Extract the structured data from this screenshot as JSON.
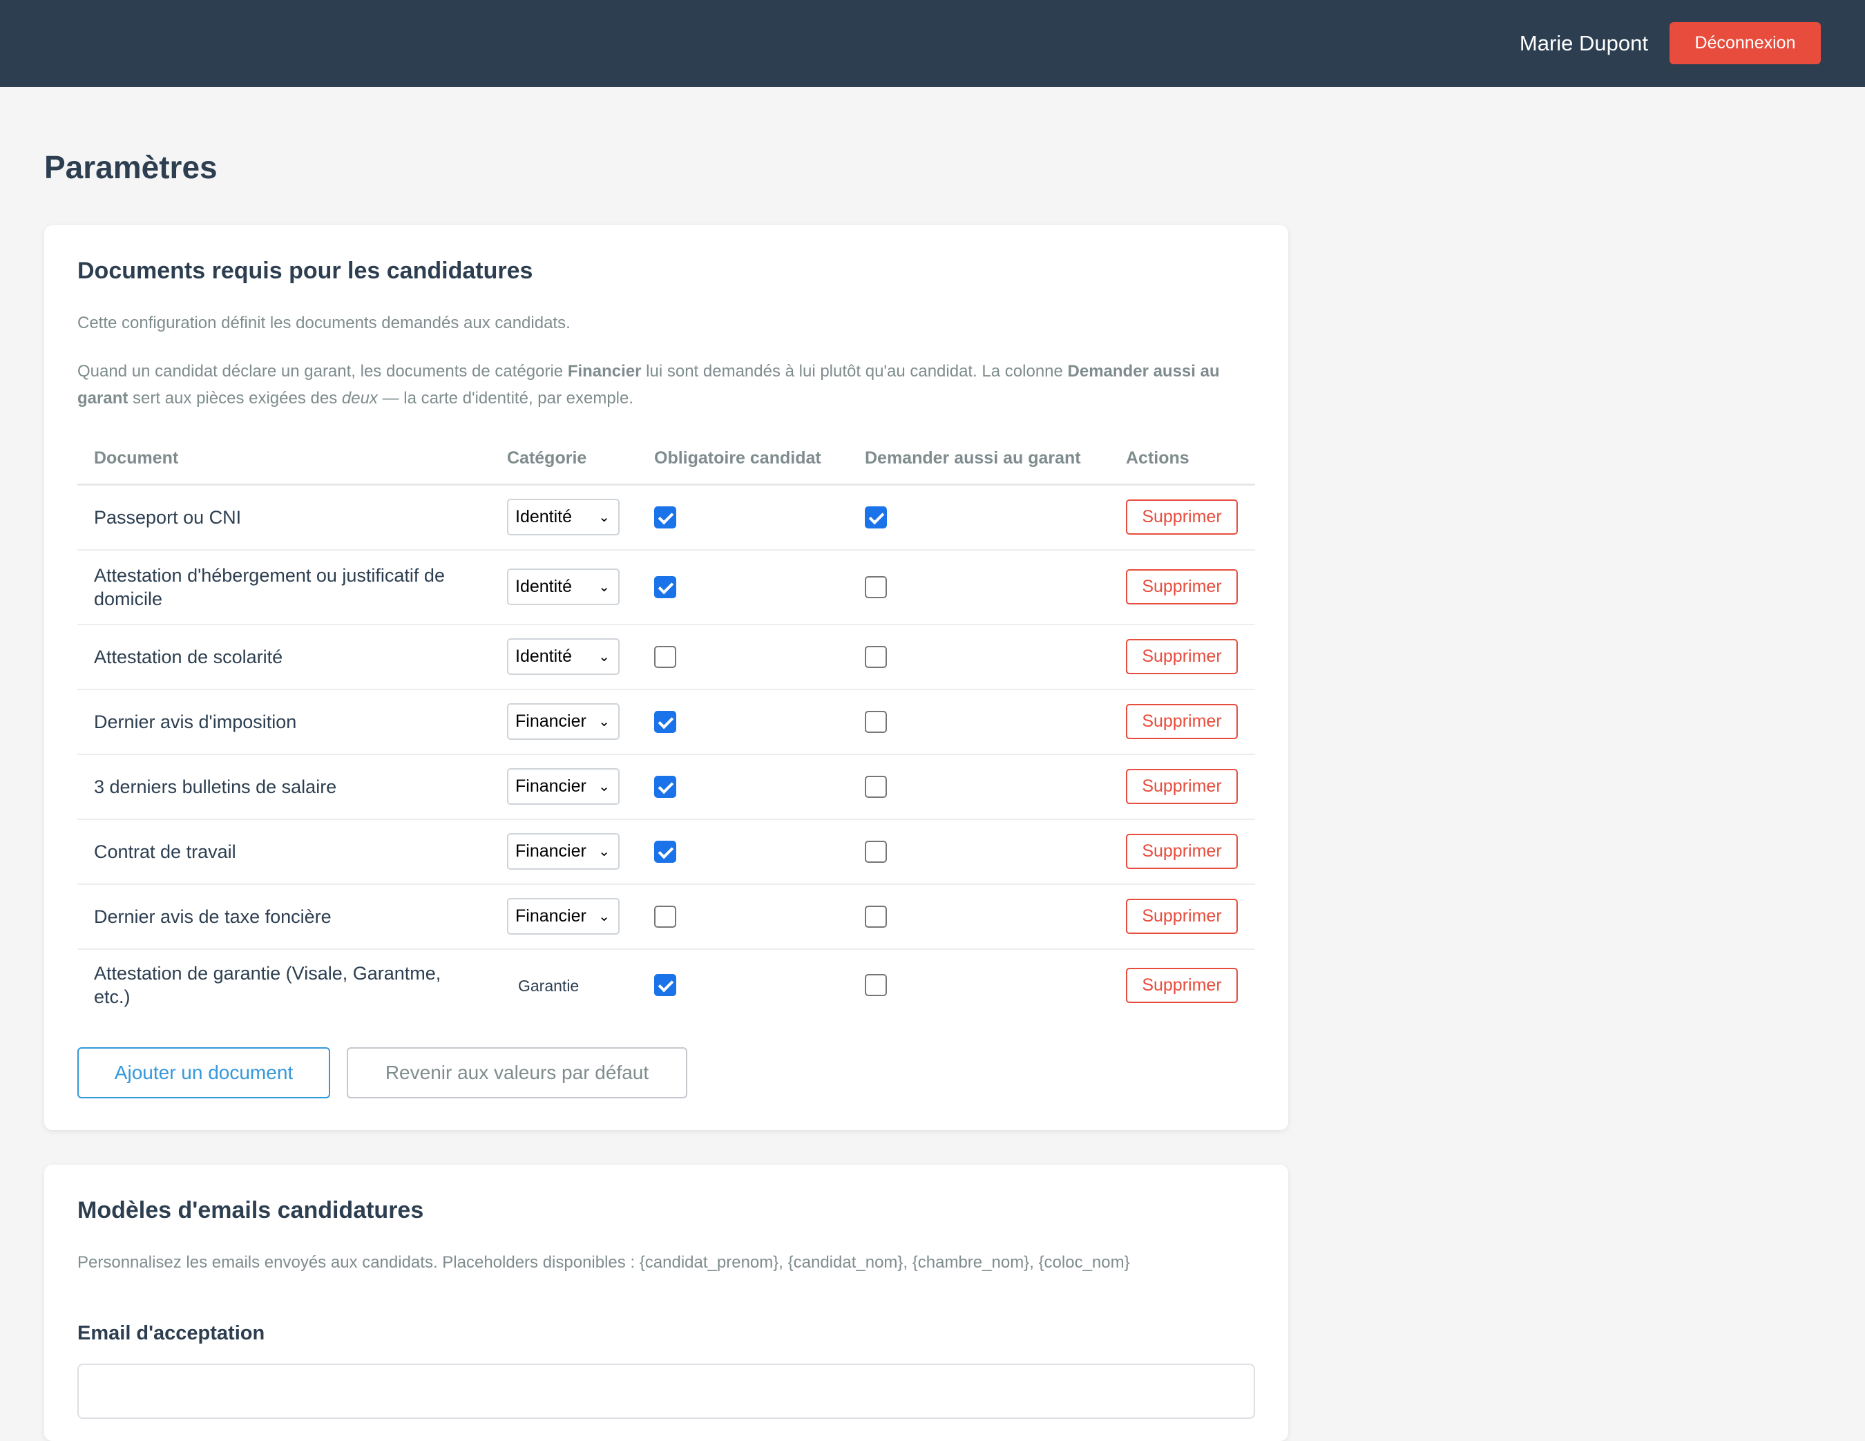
{
  "header": {
    "user_name": "Marie Dupont",
    "logout_label": "Déconnexion"
  },
  "page": {
    "title": "Paramètres"
  },
  "documents_section": {
    "title": "Documents requis pour les candidatures",
    "description": "Cette configuration définit les documents demandés aux candidats.",
    "note_part1": "Quand un candidat déclare un garant, les documents de catégorie ",
    "note_bold1": "Financier",
    "note_part2": " lui sont demandés à lui plutôt qu'au candidat. La colonne ",
    "note_bold2": "Demander aussi au garant",
    "note_part3": " sert aux pièces exigées des ",
    "note_italic": "deux",
    "note_part4": " — la carte d'identité, par exemple.",
    "columns": {
      "document": "Document",
      "category": "Catégorie",
      "required": "Obligatoire candidat",
      "guarantor": "Demander aussi au garant",
      "actions": "Actions"
    },
    "rows": [
      {
        "document": "Passeport ou CNI",
        "category": "Identité",
        "editable": true,
        "required": true,
        "guarantor": true,
        "action": "Supprimer"
      },
      {
        "document": "Attestation d'hébergement ou justificatif de domicile",
        "category": "Identité",
        "editable": true,
        "required": true,
        "guarantor": false,
        "action": "Supprimer"
      },
      {
        "document": "Attestation de scolarité",
        "category": "Identité",
        "editable": true,
        "required": false,
        "guarantor": false,
        "action": "Supprimer"
      },
      {
        "document": "Dernier avis d'imposition",
        "category": "Financier",
        "editable": true,
        "required": true,
        "guarantor": false,
        "action": "Supprimer"
      },
      {
        "document": "3 derniers bulletins de salaire",
        "category": "Financier",
        "editable": true,
        "required": true,
        "guarantor": false,
        "action": "Supprimer"
      },
      {
        "document": "Contrat de travail",
        "category": "Financier",
        "editable": true,
        "required": true,
        "guarantor": false,
        "action": "Supprimer"
      },
      {
        "document": "Dernier avis de taxe foncière",
        "category": "Financier",
        "editable": true,
        "required": false,
        "guarantor": false,
        "action": "Supprimer"
      },
      {
        "document": "Attestation de garantie (Visale, Garantme, etc.)",
        "category": "Garantie",
        "editable": false,
        "required": true,
        "guarantor": false,
        "action": "Supprimer"
      }
    ],
    "add_label": "Ajouter un document",
    "reset_label": "Revenir aux valeurs par défaut"
  },
  "emails_section": {
    "title": "Modèles d'emails candidatures",
    "description": "Personnalisez les emails envoyés aux candidats. Placeholders disponibles : {candidat_prenom}, {candidat_nom}, {chambre_nom}, {coloc_nom}",
    "acceptance_label": "Email d'acceptation"
  },
  "colors": {
    "header_bg": "#2c3e50",
    "danger": "#e74c3c",
    "primary": "#3498db",
    "checkbox": "#1a73e8"
  }
}
